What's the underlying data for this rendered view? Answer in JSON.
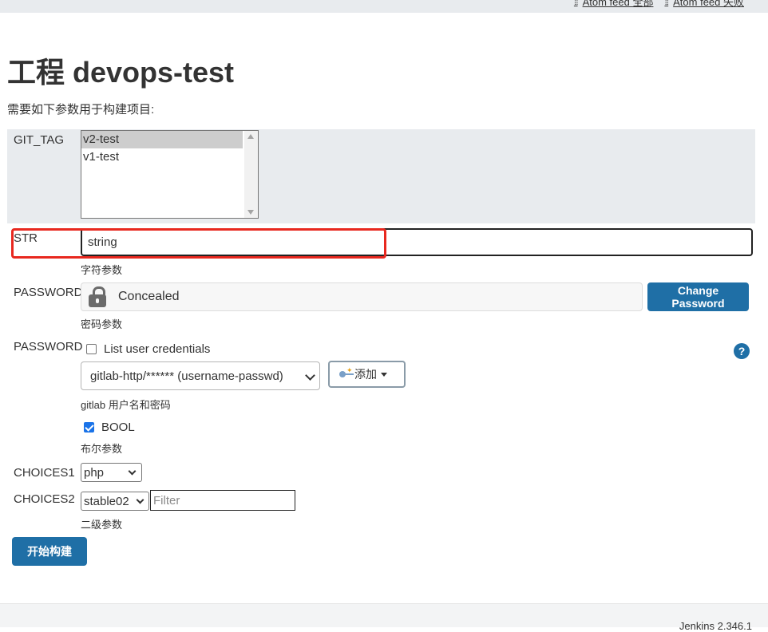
{
  "header": {
    "links": [
      {
        "label": "Atom feed 全部"
      },
      {
        "label": "Atom feed 失败"
      }
    ]
  },
  "page": {
    "title": "工程 devops-test",
    "description": "需要如下参数用于构建项目:"
  },
  "params": {
    "git_tag": {
      "label": "GIT_TAG",
      "options": [
        "v2-test",
        "v1-test"
      ],
      "selected": "v2-test"
    },
    "str": {
      "label": "STR",
      "value": "string",
      "description": "字符参数"
    },
    "password": {
      "label": "PASSWORD",
      "concealed_text": "Concealed",
      "change_button": "Change Password",
      "description": "密码参数"
    },
    "credentials": {
      "label": "PASSWORD",
      "list_user_credentials_label": "List user credentials",
      "list_user_credentials_checked": false,
      "selected": "gitlab-http/****** (username-passwd)",
      "add_button": "添加",
      "description": "gitlab 用户名和密码",
      "help": "?"
    },
    "bool": {
      "label": "BOOL",
      "checked": true,
      "description": "布尔参数"
    },
    "choices1": {
      "label": "CHOICES1",
      "selected": "php"
    },
    "choices2": {
      "label": "CHOICES2",
      "selected": "stable02",
      "filter_placeholder": "Filter",
      "description": "二级参数"
    }
  },
  "build_button": "开始构建",
  "footer": {
    "text": "Jenkins 2.346.1"
  },
  "colors": {
    "primary": "#1f6fa6",
    "highlight": "#e8281f",
    "panel": "#e8ebee"
  }
}
